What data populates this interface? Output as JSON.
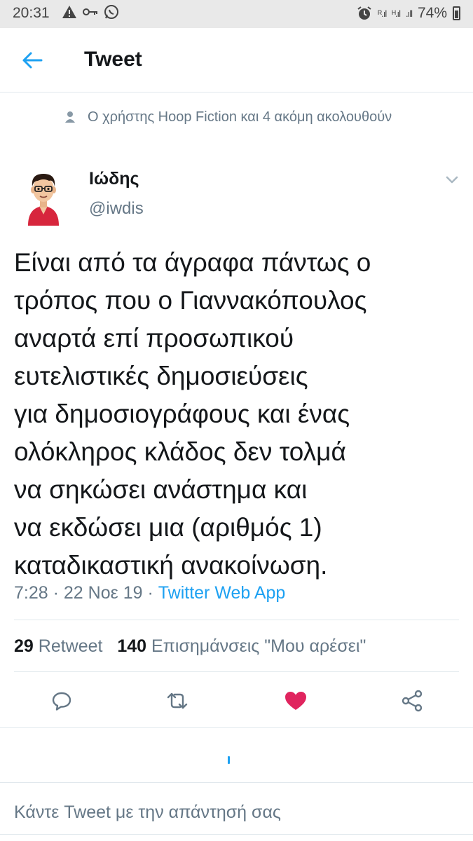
{
  "status_bar": {
    "time": "20:31",
    "battery": "74%"
  },
  "header": {
    "title": "Tweet"
  },
  "social_context": {
    "text": "Ο χρήστης Hoop Fiction και 4 ακόμη ακολουθούν"
  },
  "tweet": {
    "display_name": "Ιώδης",
    "handle": "@iwdis",
    "text_lines": [
      "Είναι από τα άγραφα πάντως ο",
      "τρόπος που ο Γιαννακόπουλος",
      "αναρτά επί προσωπικού",
      "ευτελιστικές δημοσιεύσεις",
      "για δημοσιογράφους και ένας",
      "ολόκληρος κλάδος δεν τολμά",
      "να σηκώσει ανάστημα και",
      "να εκδώσει μια (αριθμός 1)",
      "καταδικαστική ανακοίνωση."
    ],
    "time": "7:28",
    "date": "22 Νοε 19",
    "source": "Twitter Web App",
    "separator": "·"
  },
  "stats": {
    "retweet_count": "29",
    "retweet_label": "Retweet",
    "like_count": "140",
    "like_label": "Επισημάνσεις \"Μου αρέσει\""
  },
  "actions": {
    "reply_icon": "reply-icon",
    "retweet_icon": "retweet-icon",
    "like_icon": "heart-icon",
    "share_icon": "share-icon",
    "like_color": "#e0245e"
  },
  "reply": {
    "placeholder": "Κάντε Tweet με την απάντησή σας"
  },
  "colors": {
    "accent": "#1da1f2",
    "secondary_text": "#657786",
    "divider": "#e1e8ed"
  }
}
